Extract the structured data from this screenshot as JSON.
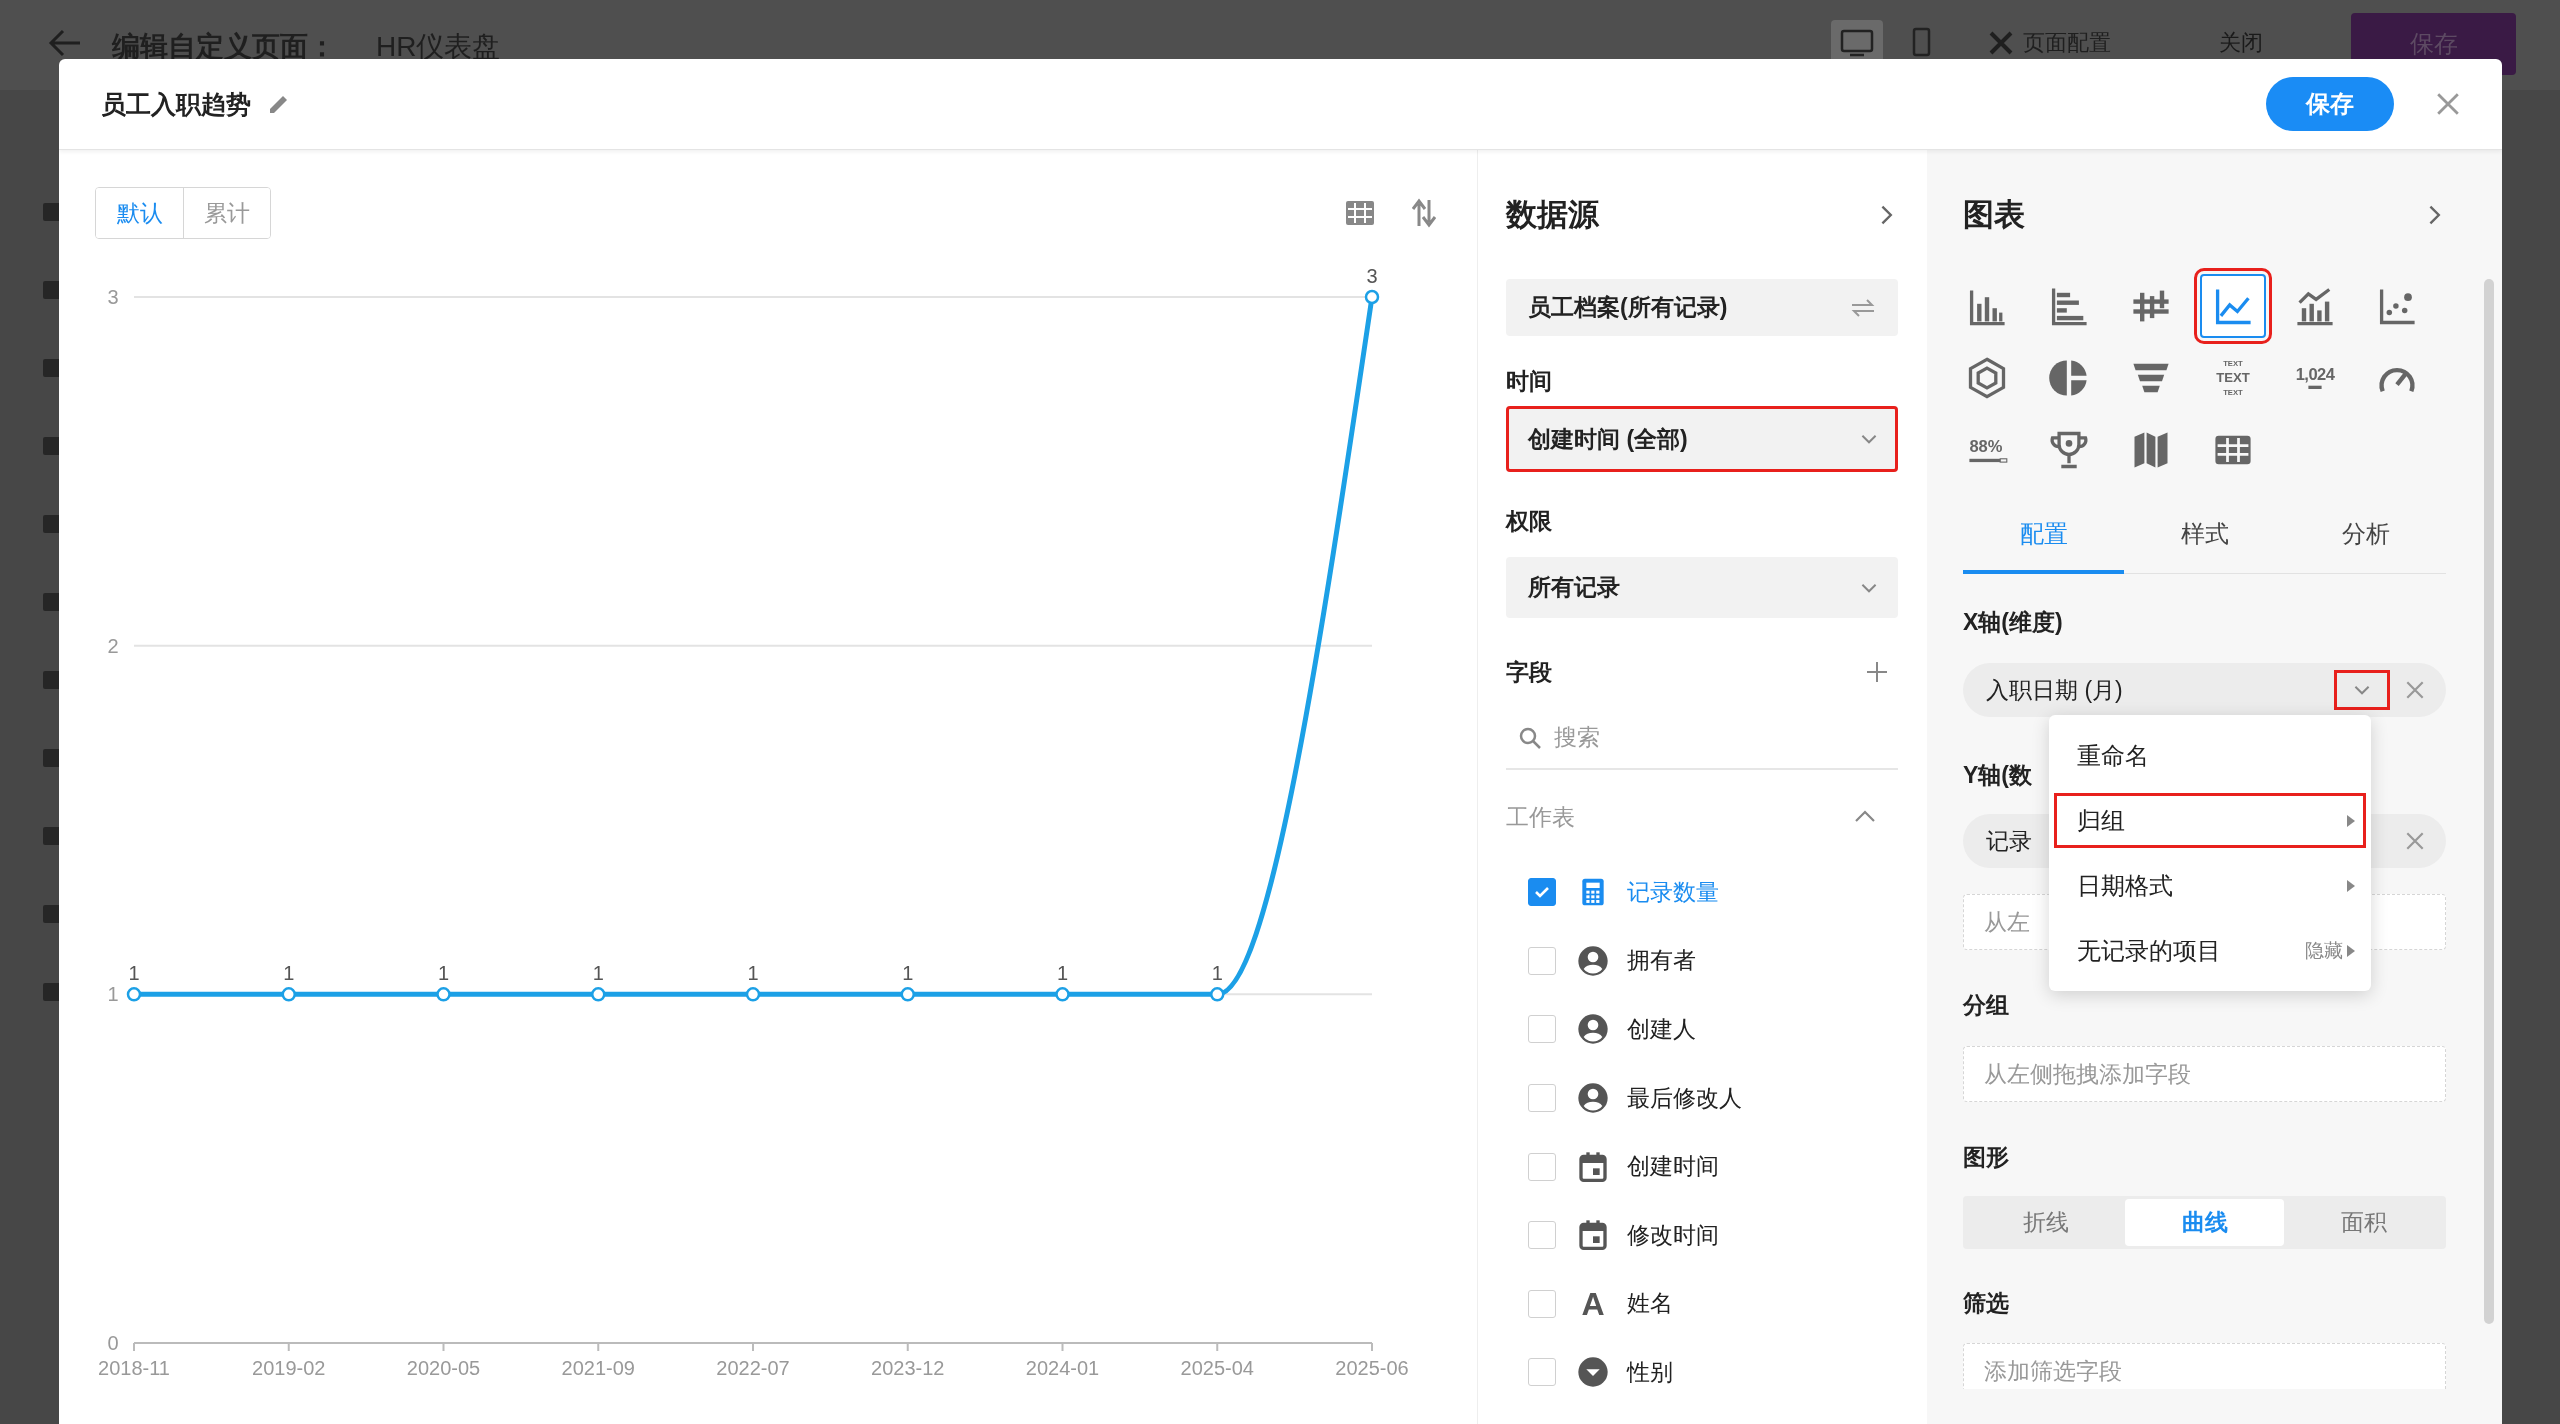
{
  "page": {
    "heading": "编辑自定义页面：",
    "title": "HR仪表盘",
    "device_modes": [
      {
        "kind": "desktop",
        "selected": true
      },
      {
        "kind": "mobile",
        "selected": false
      }
    ],
    "config_button": "页面配置",
    "close_button": "关闭",
    "save_button": "保存"
  },
  "dialog": {
    "title": "员工入职趋势",
    "save_button": "保存"
  },
  "chart_view": {
    "modes": [
      {
        "label": "默认",
        "selected": true
      },
      {
        "label": "累计",
        "selected": false
      }
    ],
    "chart_data": {
      "type": "line",
      "categories": [
        "2018-11",
        "2019-02",
        "2020-05",
        "2021-09",
        "2022-07",
        "2023-12",
        "2024-01",
        "2025-04",
        "2025-06"
      ],
      "series": [
        {
          "color": "#1ca0e6",
          "marker": "circle",
          "values": [
            1,
            1,
            1,
            1,
            1,
            1,
            1,
            1,
            3
          ]
        }
      ],
      "ylim": [
        0,
        3
      ],
      "yticks": [
        0,
        1,
        2,
        3
      ],
      "data_labels": true
    }
  },
  "data_source": {
    "title": "数据源",
    "source": "员工档案(所有记录)",
    "time_label": "时间",
    "time_value": "创建时间 (全部)",
    "time_highlighted": true,
    "permission_label": "权限",
    "permission_value": "所有记录",
    "fields_label": "字段",
    "search_placeholder": "搜索",
    "group_label": "工作表",
    "group_expanded": true,
    "fields": [
      {
        "label": "记录数量",
        "kind": "count",
        "checked": true
      },
      {
        "label": "拥有者",
        "kind": "user",
        "checked": false
      },
      {
        "label": "创建人",
        "kind": "user",
        "checked": false
      },
      {
        "label": "最后修改人",
        "kind": "user",
        "checked": false
      },
      {
        "label": "创建时间",
        "kind": "date",
        "checked": false
      },
      {
        "label": "修改时间",
        "kind": "date",
        "checked": false
      },
      {
        "label": "姓名",
        "kind": "text",
        "glyph": "A",
        "checked": false
      },
      {
        "label": "性别",
        "kind": "option",
        "checked": false
      }
    ]
  },
  "chart_settings": {
    "title": "图表",
    "chart_types": [
      {
        "kind": "column",
        "selected": false
      },
      {
        "kind": "bar",
        "selected": false
      },
      {
        "kind": "range",
        "selected": false
      },
      {
        "kind": "line",
        "selected": true,
        "highlighted": true
      },
      {
        "kind": "combo",
        "selected": false
      },
      {
        "kind": "scatter",
        "selected": false
      },
      {
        "kind": "radar",
        "selected": false
      },
      {
        "kind": "pie",
        "selected": false
      },
      {
        "kind": "funnel",
        "selected": false
      },
      {
        "kind": "text",
        "lines": [
          "TEXT",
          "TEXT",
          "TEXT"
        ],
        "selected": false
      },
      {
        "kind": "number",
        "label": "1,024",
        "selected": false
      },
      {
        "kind": "gauge",
        "selected": false
      },
      {
        "kind": "progress",
        "label": "88%",
        "selected": false
      },
      {
        "kind": "ranking",
        "selected": false
      },
      {
        "kind": "map",
        "selected": false
      },
      {
        "kind": "table",
        "selected": false
      }
    ],
    "tabs": [
      {
        "label": "配置",
        "selected": true
      },
      {
        "label": "样式",
        "selected": false
      },
      {
        "label": "分析",
        "selected": false
      }
    ],
    "x_axis": {
      "label": "X轴(维度)",
      "field": "入职日期 (月)",
      "menu_highlighted": true
    },
    "y_axis": {
      "label": "Y轴(数",
      "field": "记录",
      "placeholder": "从左"
    },
    "group": {
      "label": "分组",
      "placeholder": "从左侧拖拽添加字段"
    },
    "shape": {
      "label": "图形",
      "options": [
        {
          "label": "折线",
          "selected": false
        },
        {
          "label": "曲线",
          "selected": true
        },
        {
          "label": "面积",
          "selected": false
        }
      ]
    },
    "filter": {
      "label": "筛选",
      "placeholder": "添加筛选字段"
    },
    "menu": {
      "items": [
        {
          "label": "重命名",
          "submenu": false,
          "highlighted": false
        },
        {
          "label": "归组",
          "submenu": true,
          "highlighted": true
        },
        {
          "label": "日期格式",
          "submenu": true,
          "highlighted": false
        },
        {
          "label": "无记录的项目",
          "value": "隐藏",
          "submenu": true,
          "highlighted": false
        }
      ]
    }
  }
}
